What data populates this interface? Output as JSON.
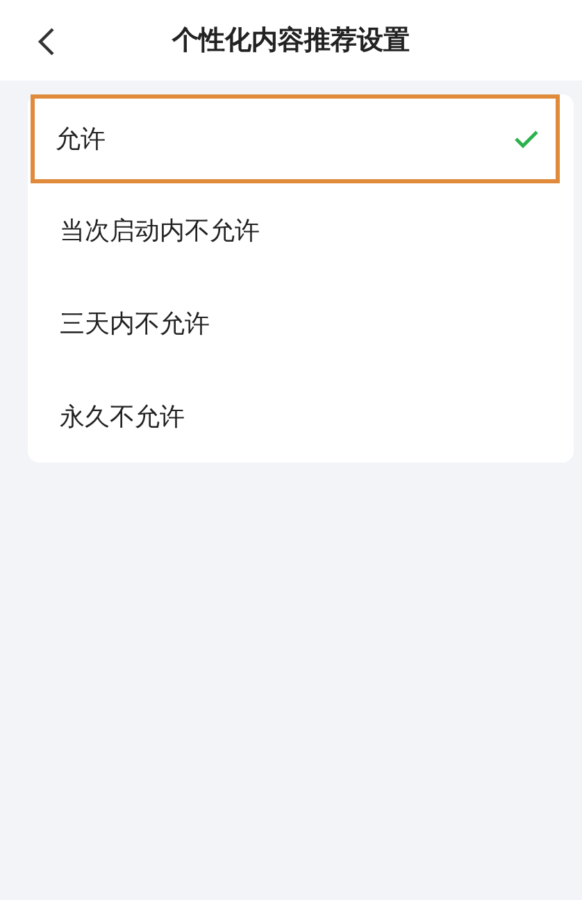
{
  "header": {
    "title": "个性化内容推荐设置"
  },
  "options": [
    {
      "label": "允许",
      "selected": true
    },
    {
      "label": "当次启动内不允许",
      "selected": false
    },
    {
      "label": "三天内不允许",
      "selected": false
    },
    {
      "label": "永久不允许",
      "selected": false
    }
  ]
}
